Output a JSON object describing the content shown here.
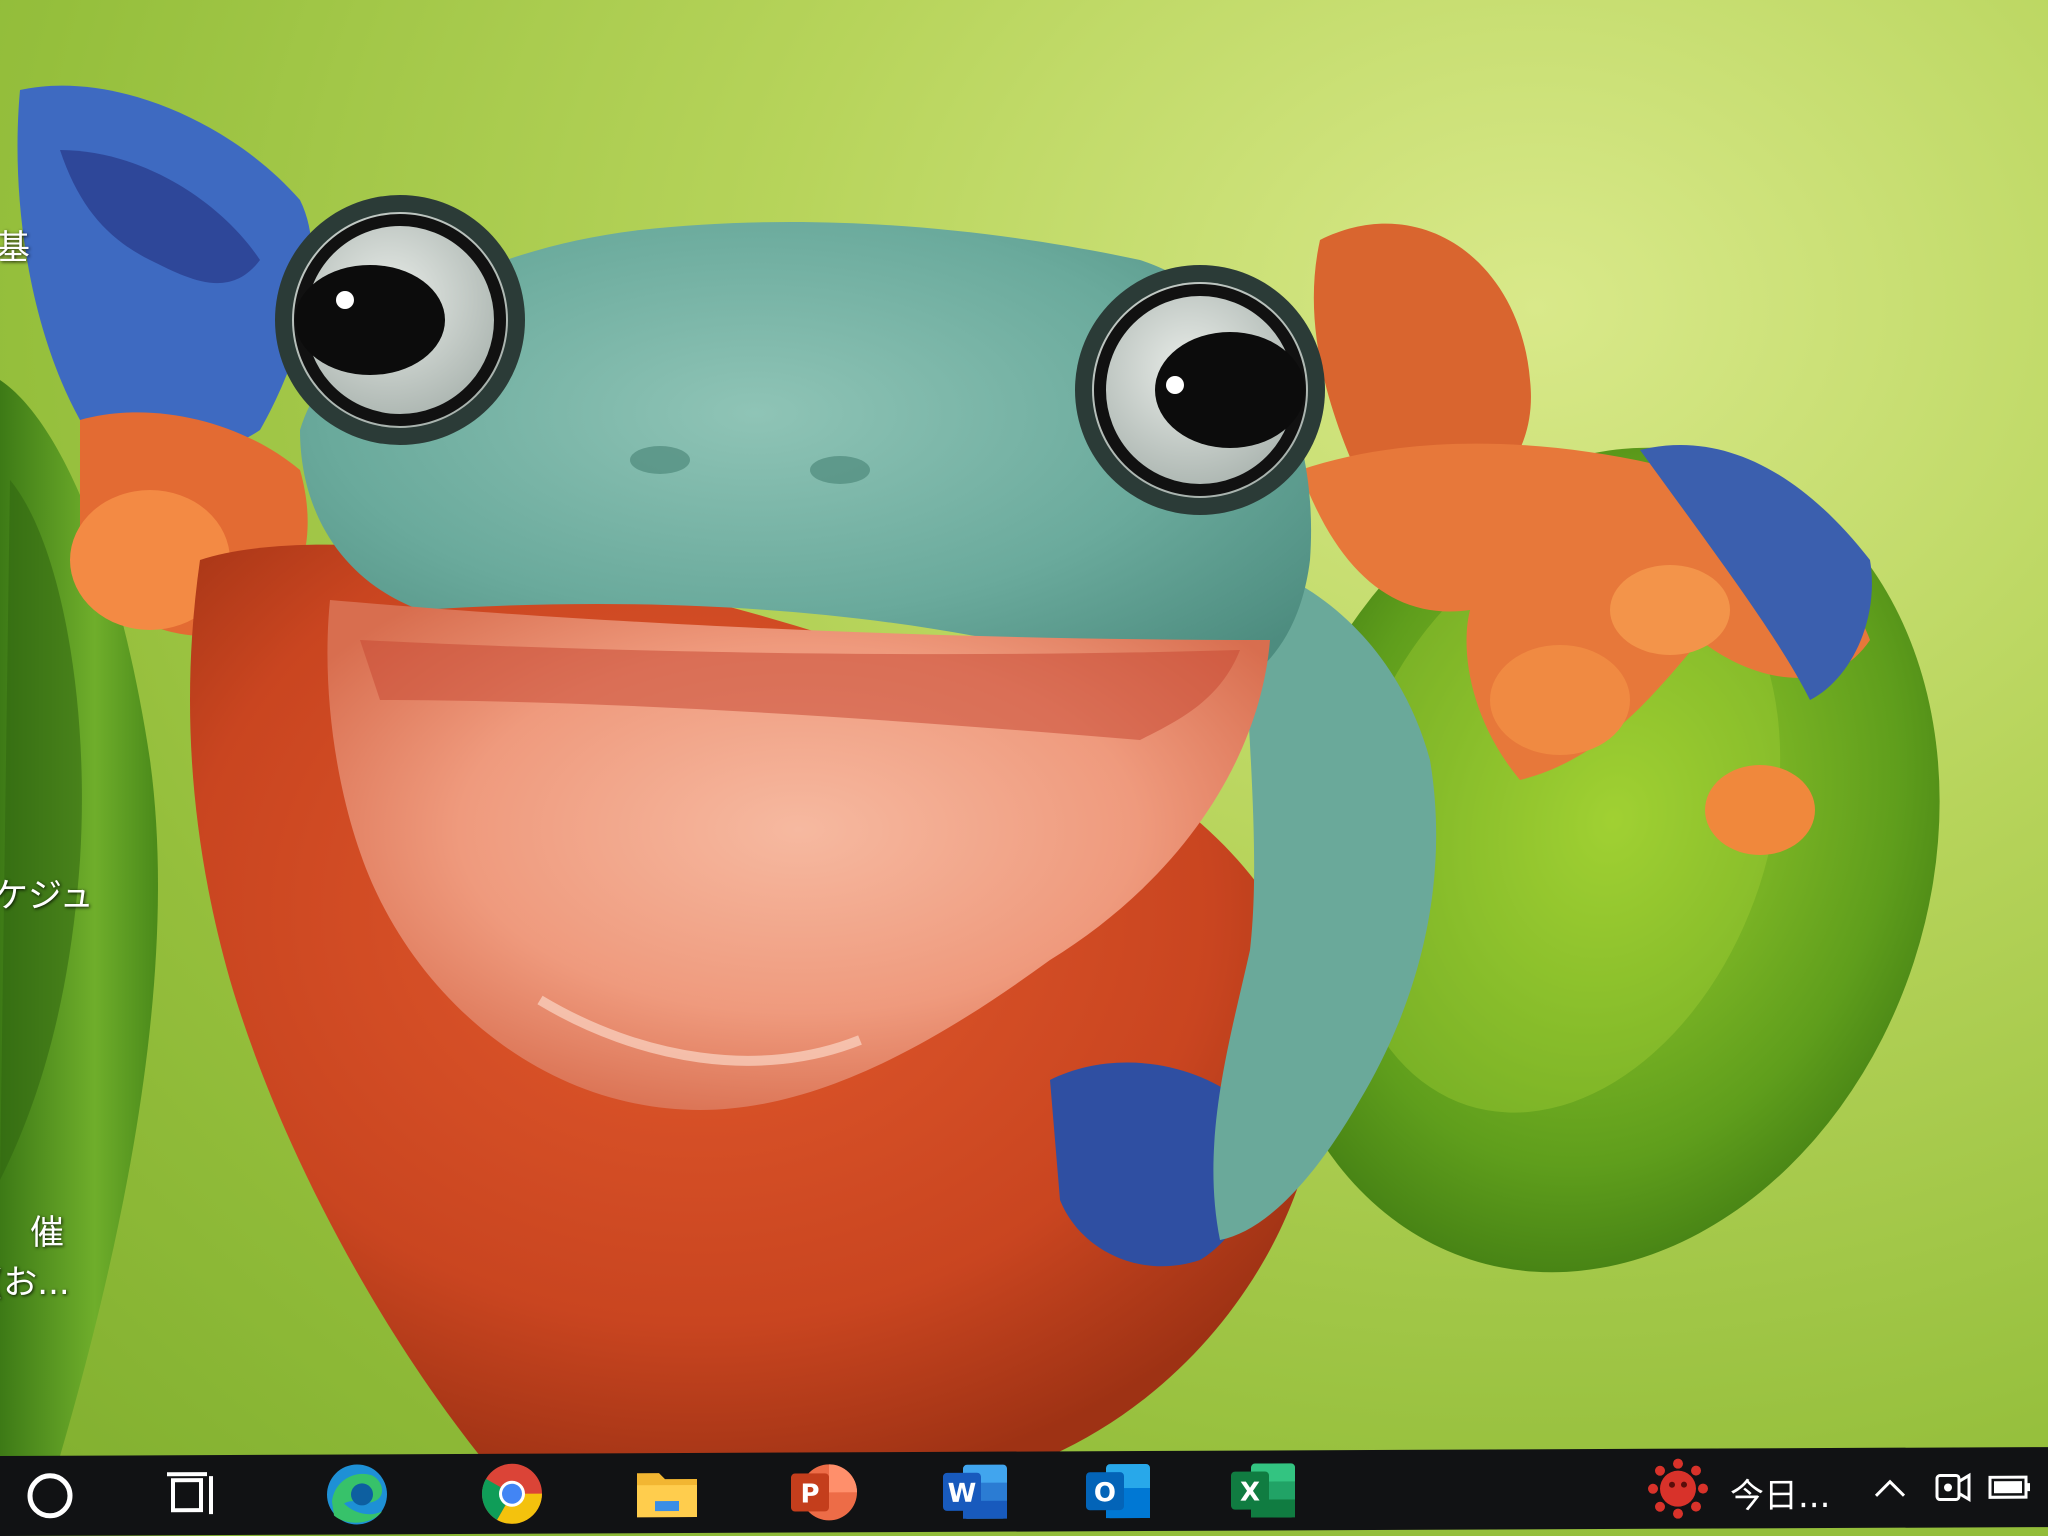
{
  "desktop": {
    "labels": [
      {
        "id": "label-1",
        "text": "基"
      },
      {
        "id": "label-2",
        "text": "ケジュ"
      },
      {
        "id": "label-3",
        "text": "催"
      },
      {
        "id": "label-4",
        "text": "(お..."
      }
    ]
  },
  "taskbar": {
    "search_icon": "search-icon",
    "task_view_icon": "task-view-icon",
    "pinned_apps": [
      {
        "name": "Microsoft Edge",
        "icon": "edge-icon"
      },
      {
        "name": "Google Chrome",
        "icon": "chrome-icon"
      },
      {
        "name": "File Explorer",
        "icon": "folder-icon"
      },
      {
        "name": "PowerPoint",
        "icon": "powerpoint-icon",
        "letter": "P"
      },
      {
        "name": "Word",
        "icon": "word-icon",
        "letter": "W"
      },
      {
        "name": "Outlook",
        "icon": "outlook-icon",
        "letter": "O"
      },
      {
        "name": "Excel",
        "icon": "excel-icon",
        "letter": "X"
      }
    ],
    "tray": {
      "news_text": "今日...",
      "news_icon": "virus-news-icon",
      "chevron_icon": "chevron-up-icon",
      "meet_icon": "meet-now-icon",
      "battery_icon": "battery-icon"
    }
  },
  "colors": {
    "taskbar": "#111214",
    "wallpaper_green": "#a9cc4a",
    "edge": "#1e90d6",
    "powerpoint": "#d24726",
    "word": "#2b579a",
    "outlook": "#0078d4",
    "excel": "#217346"
  }
}
